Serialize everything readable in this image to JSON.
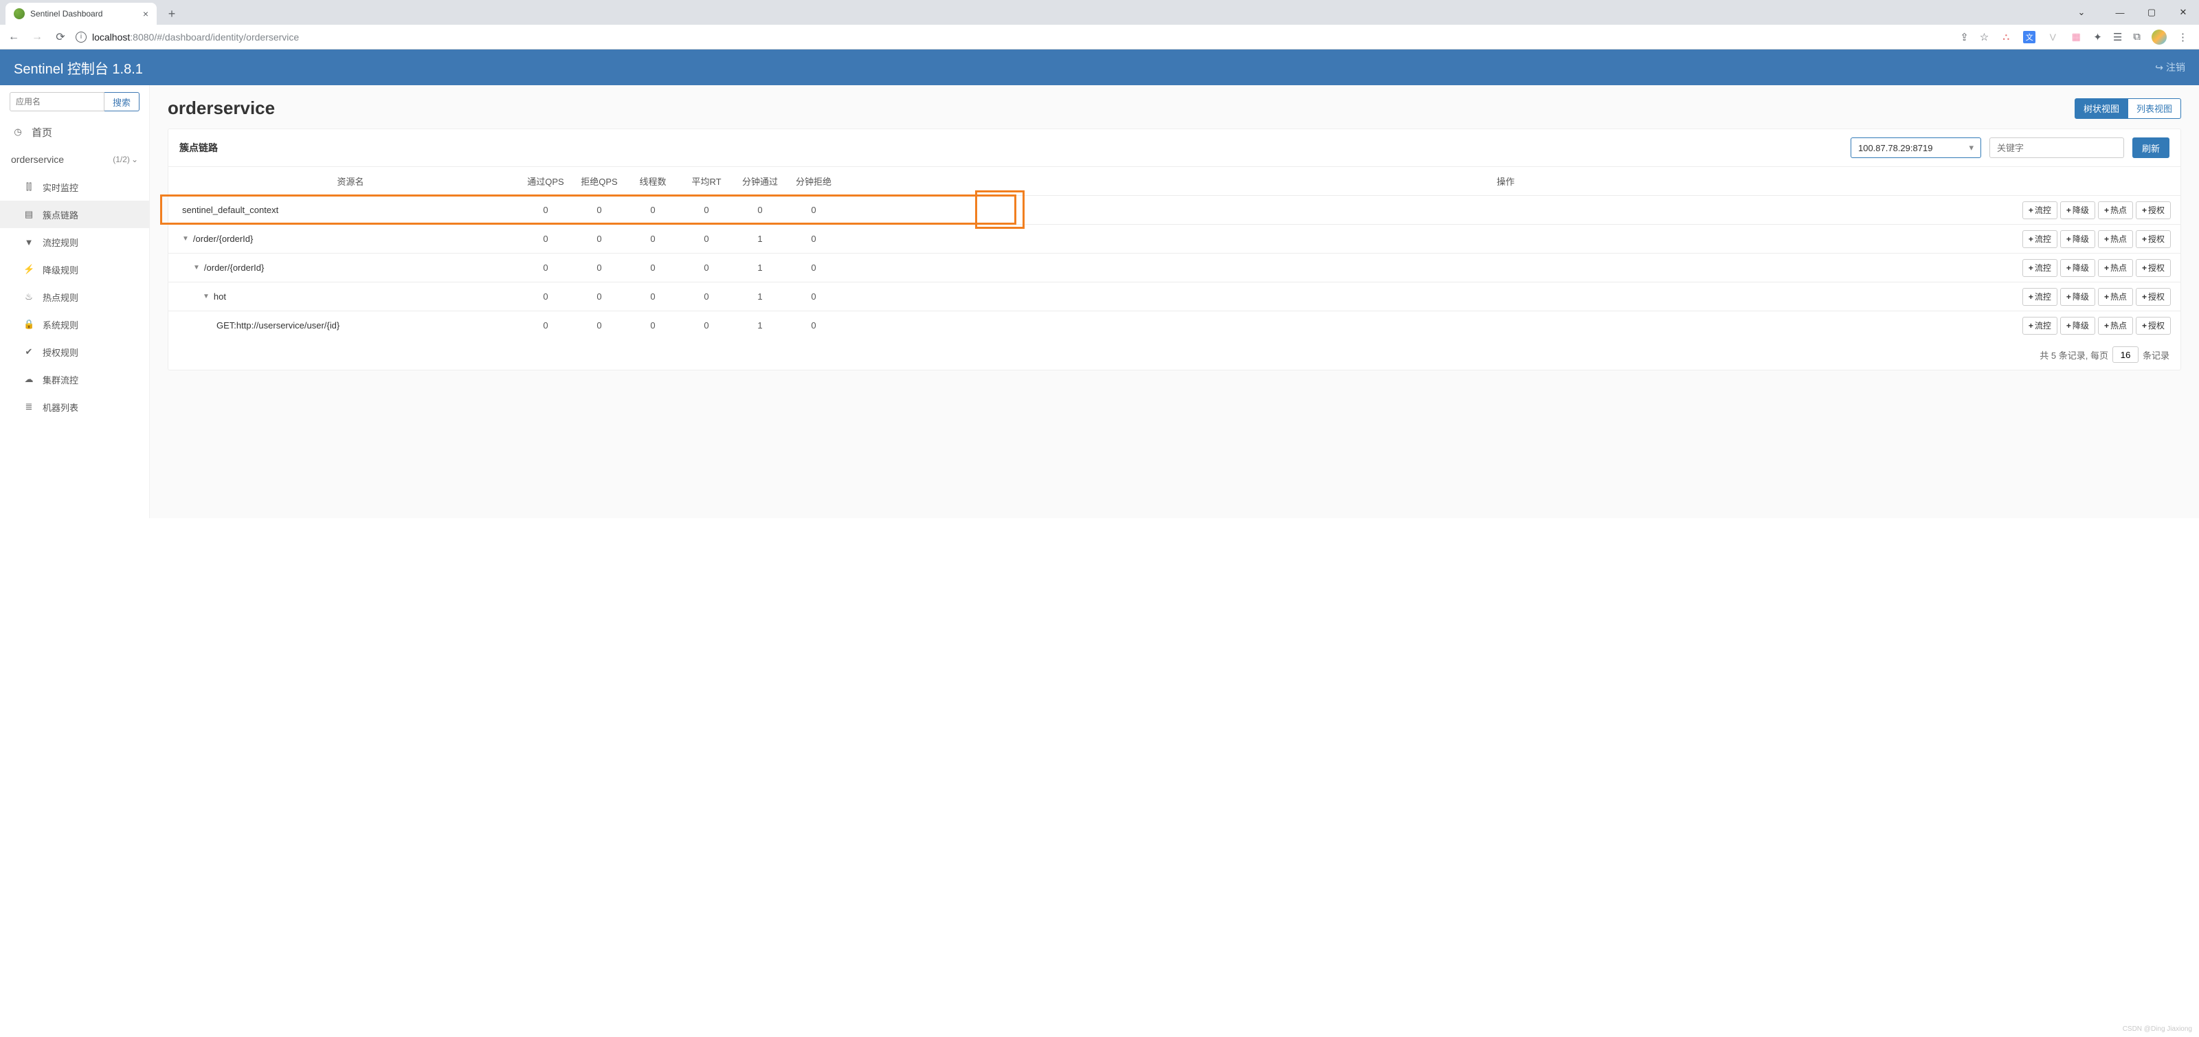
{
  "browser": {
    "tab_title": "Sentinel Dashboard",
    "new_tab": "+",
    "url_host": "localhost",
    "url_port": ":8080",
    "url_path": "/#/dashboard/identity/orderservice"
  },
  "header": {
    "title": "Sentinel 控制台 1.8.1",
    "logout": "注销"
  },
  "sidebar": {
    "search_placeholder": "应用名",
    "search_btn": "搜索",
    "home": "首页",
    "app_name": "orderservice",
    "app_count": "(1/2)",
    "items": [
      {
        "icon": "chart",
        "label": "实时监控"
      },
      {
        "icon": "list",
        "label": "簇点链路"
      },
      {
        "icon": "filter",
        "label": "流控规则"
      },
      {
        "icon": "bolt",
        "label": "降级规则"
      },
      {
        "icon": "fire",
        "label": "热点规则"
      },
      {
        "icon": "lock",
        "label": "系统规则"
      },
      {
        "icon": "check",
        "label": "授权规则"
      },
      {
        "icon": "cloud",
        "label": "集群流控"
      },
      {
        "icon": "bars",
        "label": "机器列表"
      }
    ]
  },
  "page": {
    "title": "orderservice",
    "view_tree": "树状视图",
    "view_list": "列表视图"
  },
  "panel": {
    "title": "簇点链路",
    "machine": "100.87.78.29:8719",
    "keyword_placeholder": "关键字",
    "refresh": "刷新"
  },
  "columns": {
    "res": "资源名",
    "pass": "通过QPS",
    "reject": "拒绝QPS",
    "threads": "线程数",
    "rt": "平均RT",
    "min_pass": "分钟通过",
    "min_reject": "分钟拒绝",
    "ops": "操作"
  },
  "ops": {
    "flow": "流控",
    "degrade": "降级",
    "hot": "热点",
    "auth": "授权"
  },
  "rows": [
    {
      "indent": 1,
      "caret": false,
      "name": "sentinel_default_context",
      "pass": "0",
      "reject": "0",
      "threads": "0",
      "rt": "0",
      "min_pass": "0",
      "min_reject": "0"
    },
    {
      "indent": 1,
      "caret": true,
      "name": "/order/{orderId}",
      "pass": "0",
      "reject": "0",
      "threads": "0",
      "rt": "0",
      "min_pass": "1",
      "min_reject": "0"
    },
    {
      "indent": 2,
      "caret": true,
      "name": "/order/{orderId}",
      "pass": "0",
      "reject": "0",
      "threads": "0",
      "rt": "0",
      "min_pass": "1",
      "min_reject": "0"
    },
    {
      "indent": 3,
      "caret": true,
      "name": "hot",
      "pass": "0",
      "reject": "0",
      "threads": "0",
      "rt": "0",
      "min_pass": "1",
      "min_reject": "0"
    },
    {
      "indent": 4,
      "caret": false,
      "name": "GET:http://userservice/user/{id}",
      "pass": "0",
      "reject": "0",
      "threads": "0",
      "rt": "0",
      "min_pass": "1",
      "min_reject": "0"
    }
  ],
  "pager": {
    "prefix": "共 5 条记录, 每页",
    "value": "16",
    "suffix": "条记录"
  },
  "watermark": "CSDN @Ding Jiaxiong"
}
